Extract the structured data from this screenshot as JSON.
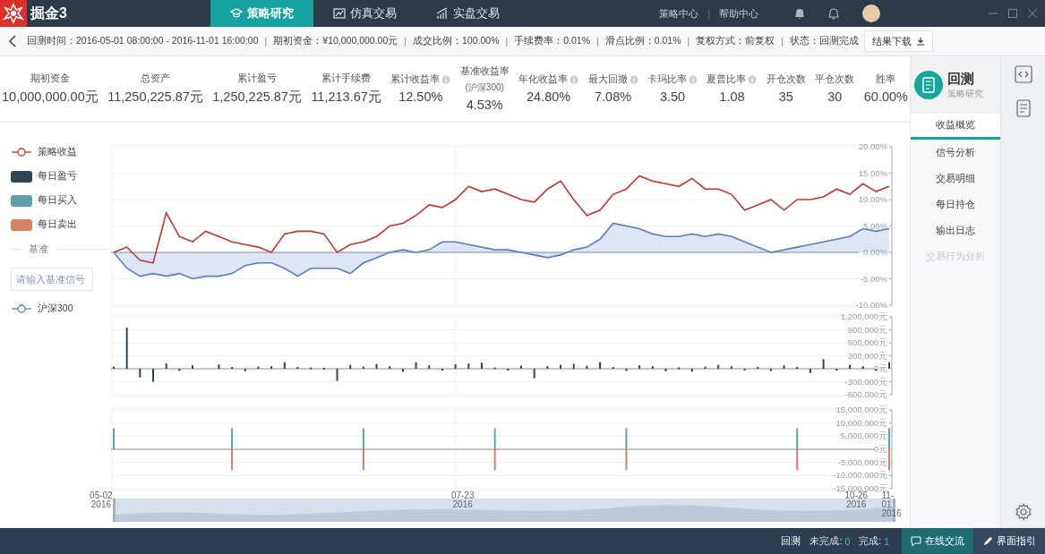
{
  "app": {
    "name": "掘金3"
  },
  "nav_tabs": [
    {
      "label": "策略研究",
      "selected": true
    },
    {
      "label": "仿真交易",
      "selected": false
    },
    {
      "label": "实盘交易",
      "selected": false
    }
  ],
  "header_links": {
    "items": [
      "策略中心",
      "帮助中心"
    ],
    "separator": "|"
  },
  "info_bar": {
    "items": [
      "回测时间：2016-05-01 08:00:00 - 2016-11-01 16:00:00",
      "期初资金：¥10,000,000.00元",
      "成交比例：100.00%",
      "手续费率：0.01%",
      "滑点比例：0.01%",
      "复权方式：前复权",
      "状态：回测完成"
    ],
    "separator": "|",
    "download_button": "结果下载"
  },
  "metrics": [
    {
      "label": "期初资金",
      "value": "10,000,000.00元",
      "info": false
    },
    {
      "label": "总资产",
      "value": "11,250,225.87元",
      "info": false
    },
    {
      "label": "累计盈亏",
      "value": "1,250,225.87元",
      "info": false
    },
    {
      "label": "累计手续费",
      "value": "11,213.67元",
      "info": false
    },
    {
      "label": "累计收益率",
      "value": "12.50%",
      "info": true
    },
    {
      "label": "基准收益率",
      "sublabel": "(沪深300)",
      "value": "4.53%",
      "info": false
    },
    {
      "label": "年化收益率",
      "value": "24.80%",
      "info": true
    },
    {
      "label": "最大回撤",
      "value": "7.08%",
      "info": true
    },
    {
      "label": "卡玛比率",
      "value": "3.50",
      "info": true
    },
    {
      "label": "夏普比率",
      "value": "1.08",
      "info": true
    },
    {
      "label": "开仓次数",
      "value": "35",
      "info": false
    },
    {
      "label": "平仓次数",
      "value": "30",
      "info": false
    },
    {
      "label": "胜率",
      "value": "60.00%",
      "info": false
    }
  ],
  "benchmark": {
    "heading": "基准",
    "placeholder": "请输入基准信号"
  },
  "charts": [
    {
      "chart_data": {
        "type": "line",
        "grid": true,
        "ylim": [
          -10,
          20
        ],
        "yticks": [
          {
            "value": 20,
            "label": "20.00%"
          },
          {
            "value": 15,
            "label": "15.00%"
          },
          {
            "value": 10,
            "label": "10.00%"
          },
          {
            "value": 5,
            "label": "5.00%"
          },
          {
            "value": 0,
            "label": "0.00%"
          },
          {
            "value": -5,
            "label": "-5.00%"
          },
          {
            "value": -10,
            "label": "-10.00%"
          }
        ],
        "series": [
          {
            "name": "策略收益",
            "color": "#c23531",
            "values": [
              0,
              1,
              -1.5,
              -2,
              7.5,
              3,
              2,
              4,
              3,
              2,
              1.5,
              1,
              0,
              3.5,
              4,
              4,
              3.5,
              0,
              1.5,
              2,
              3,
              5,
              5.5,
              7,
              9,
              8.5,
              10,
              12.5,
              11.5,
              12,
              11,
              10,
              9.5,
              12,
              13.5,
              10,
              7,
              8,
              11,
              12,
              14.5,
              13.5,
              13,
              12.5,
              14,
              12,
              12,
              11,
              8,
              9,
              10,
              8,
              10,
              10,
              10.5,
              12,
              11,
              13,
              11.5,
              12.5
            ]
          },
          {
            "name": "沪深300",
            "color": "#5b7bc4",
            "values": [
              0,
              -3,
              -4.5,
              -4,
              -4.5,
              -4,
              -5,
              -4.5,
              -4.5,
              -4,
              -2.5,
              -2,
              -2,
              -3,
              -4.5,
              -3,
              -3,
              -3,
              -4,
              -2,
              -1,
              0,
              0.5,
              0,
              0.5,
              2,
              2,
              1.5,
              1,
              0.5,
              0.5,
              0,
              -0.5,
              -1,
              -0.5,
              0.5,
              1,
              2.5,
              5.5,
              5,
              4.5,
              3.5,
              3,
              3,
              3.5,
              3,
              3.5,
              3,
              2,
              1,
              0,
              0.5,
              1,
              1.5,
              2,
              2.5,
              3,
              4.5,
              4,
              4.5
            ]
          }
        ]
      }
    },
    {
      "chart_data": {
        "type": "bar",
        "grid": true,
        "ylim": [
          -600000,
          1200000
        ],
        "yticks": [
          {
            "value": 1200000,
            "label": "1,200,000元"
          },
          {
            "value": 900000,
            "label": "900,000元"
          },
          {
            "value": 600000,
            "label": "600,000元"
          },
          {
            "value": 300000,
            "label": "300,000元"
          },
          {
            "value": 0,
            "label": "0元"
          },
          {
            "value": -300000,
            "label": "-300,000元"
          },
          {
            "value": -600000,
            "label": "-600,000元"
          }
        ],
        "series": [
          {
            "name": "每日盈亏",
            "color": "#2f4554",
            "values": [
              50000,
              950000,
              -200000,
              -300000,
              120000,
              -50000,
              80000,
              0,
              100000,
              40000,
              -60000,
              50000,
              60000,
              150000,
              40000,
              30000,
              20000,
              -280000,
              90000,
              50000,
              110000,
              60000,
              -70000,
              150000,
              80000,
              -40000,
              100000,
              120000,
              140000,
              30000,
              -40000,
              70000,
              -220000,
              60000,
              90000,
              110000,
              70000,
              150000,
              40000,
              -50000,
              80000,
              60000,
              -60000,
              30000,
              -70000,
              50000,
              90000,
              60000,
              -40000,
              40000,
              -50000,
              80000,
              40000,
              -100000,
              220000,
              -40000,
              90000,
              60000,
              -30000,
              150000
            ]
          }
        ]
      }
    },
    {
      "chart_data": {
        "type": "bar",
        "grid": true,
        "ylim": [
          -15000000,
          15000000
        ],
        "yticks": [
          {
            "value": 15000000,
            "label": "15,000,000元"
          },
          {
            "value": 10000000,
            "label": "10,000,000元"
          },
          {
            "value": 5000000,
            "label": "5,000,000元"
          },
          {
            "value": 0,
            "label": "0元"
          },
          {
            "value": -5000000,
            "label": "-5,000,000元"
          },
          {
            "value": -10000000,
            "label": "-10,000,000元"
          },
          {
            "value": -15000000,
            "label": "-15,000,000元"
          }
        ],
        "series": [
          {
            "name": "每日买入",
            "color": "#61a0a8",
            "values": [
              8000000,
              0,
              0,
              0,
              0,
              0,
              0,
              0,
              0,
              8000000,
              0,
              0,
              0,
              0,
              0,
              0,
              0,
              0,
              0,
              8000000,
              0,
              0,
              0,
              0,
              0,
              0,
              0,
              0,
              0,
              8000000,
              0,
              0,
              0,
              0,
              0,
              0,
              0,
              0,
              0,
              8000000,
              0,
              0,
              0,
              0,
              0,
              0,
              0,
              0,
              0,
              0,
              0,
              0,
              8000000,
              0,
              0,
              0,
              0,
              0,
              0,
              8000000
            ]
          },
          {
            "name": "每日卖出",
            "color": "#d48265",
            "values": [
              0,
              0,
              0,
              0,
              0,
              0,
              0,
              0,
              0,
              -8000000,
              0,
              0,
              0,
              0,
              0,
              0,
              0,
              0,
              0,
              -8000000,
              0,
              0,
              0,
              0,
              0,
              0,
              0,
              0,
              0,
              -8000000,
              0,
              0,
              0,
              0,
              0,
              0,
              0,
              0,
              0,
              -8000000,
              0,
              0,
              0,
              0,
              0,
              0,
              0,
              0,
              0,
              0,
              0,
              0,
              -8000000,
              0,
              0,
              0,
              0,
              0,
              0,
              -8000000
            ]
          }
        ]
      }
    }
  ],
  "range_slider": {
    "level": 1
  },
  "slider_labels": [
    {
      "date": "05-02",
      "year": "2016"
    },
    {
      "date": "07-23",
      "year": "2016"
    },
    {
      "date": "10-26",
      "year": "2016"
    },
    {
      "date": "11-01",
      "year": "2016"
    }
  ],
  "side_panel": {
    "title": "回测",
    "subtitle": "策略研究",
    "tabs": [
      {
        "label": "收益概览",
        "selected": true,
        "disabled": false
      },
      {
        "label": "信号分析",
        "selected": false,
        "disabled": false
      },
      {
        "label": "交易明细",
        "selected": false,
        "disabled": false
      },
      {
        "label": "每日持仓",
        "selected": false,
        "disabled": false
      },
      {
        "label": "输出日志",
        "selected": false,
        "disabled": false
      },
      {
        "label": "交易行为分析",
        "selected": false,
        "disabled": true
      }
    ]
  },
  "status_bar": {
    "mode": "回测",
    "pending_label": "未完成:",
    "pending": "0",
    "done_label": "完成:",
    "done": "1",
    "buttons": [
      "在线交流",
      "界面指引"
    ]
  }
}
